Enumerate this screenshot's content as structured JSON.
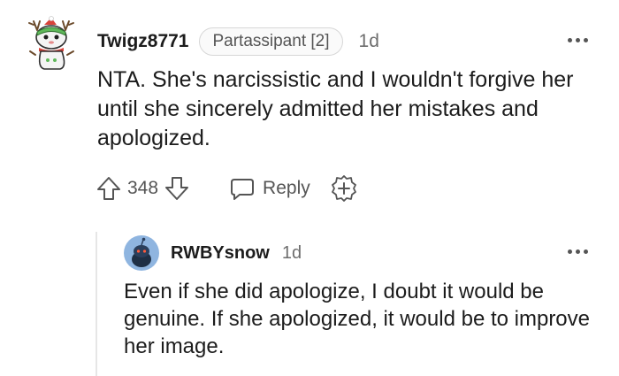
{
  "comment": {
    "author": "Twigz8771",
    "flair": "Partassipant [2]",
    "time": "1d",
    "body": "NTA. She's narcissistic and I wouldn't forgive her until she sincerely admitted her mistakes and apologized.",
    "votes": "348",
    "reply_label": "Reply"
  },
  "reply": {
    "author": "RWBYsnow",
    "time": "1d",
    "body": "Even if she did apologize, I doubt it would be genuine. If she apologized, it would be to improve her image."
  },
  "colors": {
    "text": "#1c1c1c",
    "meta": "#6d6d6d",
    "icon": "#555555",
    "avatar_green": "#5fb85a",
    "avatar_blue": "#5b8fc7"
  },
  "icons": {
    "upvote": "arrow-up-outline",
    "downvote": "arrow-down-outline",
    "reply": "speech-bubble-outline",
    "award": "plus-circle-badge",
    "more": "three-dots"
  }
}
